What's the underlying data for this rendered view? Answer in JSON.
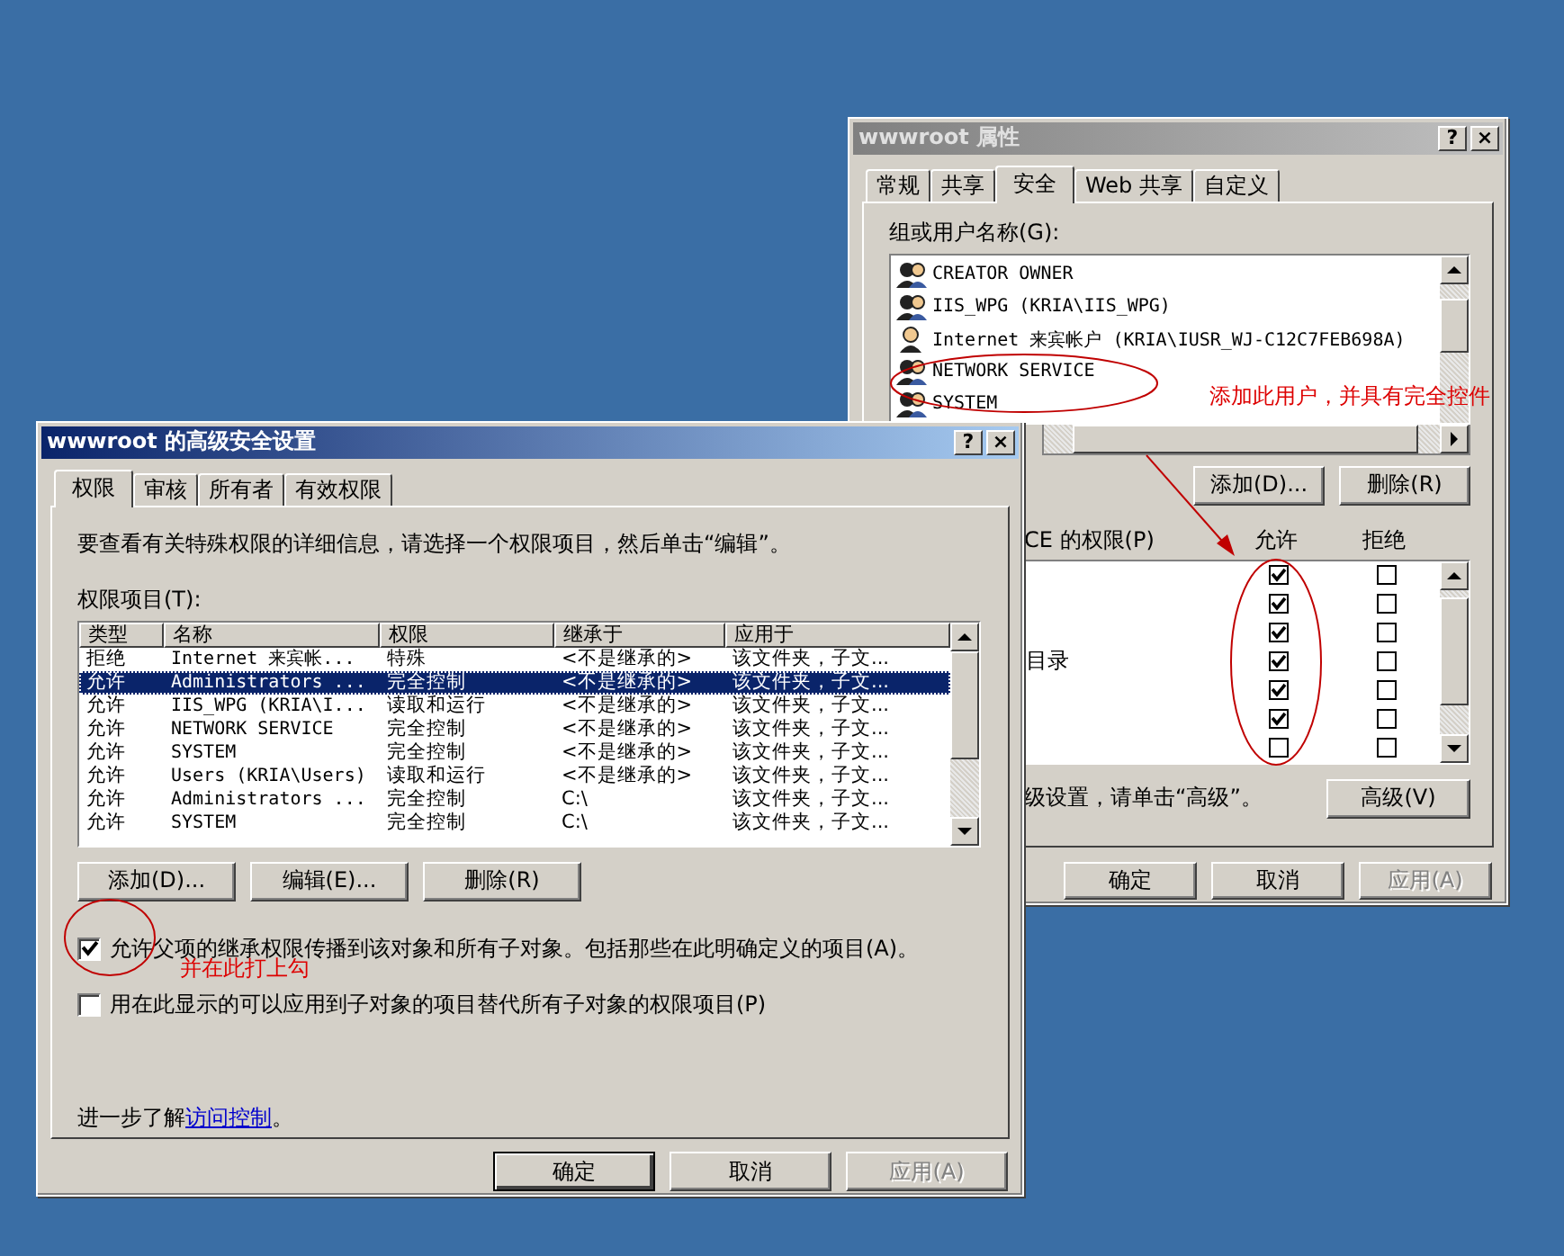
{
  "back_window": {
    "title": "wwwroot 属性",
    "controls": [
      "?",
      "×"
    ],
    "tabs": [
      {
        "label": "常规",
        "selected": false
      },
      {
        "label": "共享",
        "selected": false
      },
      {
        "label": "安全",
        "selected": true
      },
      {
        "label": "Web 共享",
        "selected": false
      },
      {
        "label": "自定义",
        "selected": false
      }
    ],
    "users_label": "组或用户名称(G):",
    "users": [
      {
        "name": "CREATOR OWNER",
        "kind": "group"
      },
      {
        "name": "IIS_WPG (KRIA\\IIS_WPG)",
        "kind": "group"
      },
      {
        "name": "Internet 来宾帐户 (KRIA\\IUSR_WJ-C12C7FEB698A)",
        "kind": "user"
      },
      {
        "name": "NETWORK SERVICE",
        "kind": "group"
      },
      {
        "name": "SYSTEM",
        "kind": "group"
      }
    ],
    "user_buttons": [
      "添加(D)...",
      "删除(R)"
    ],
    "permissions": {
      "label": "CE 的权限(P)",
      "allow_label": "允许",
      "deny_label": "拒绝",
      "rows": [
        {
          "allow": true,
          "deny": false
        },
        {
          "allow": true,
          "deny": false
        },
        {
          "allow": true,
          "deny": false
        },
        {
          "name": "目录",
          "allow": true,
          "deny": false
        },
        {
          "allow": true,
          "deny": false
        },
        {
          "allow": true,
          "deny": false
        },
        {
          "allow": false,
          "deny": false
        }
      ]
    },
    "advanced_hint": "级设置，请单击“高级”。",
    "advanced_button": "高级(V)",
    "buttons": [
      {
        "label": "确定",
        "disabled": false
      },
      {
        "label": "取消",
        "disabled": false
      },
      {
        "label": "应用(A)",
        "disabled": true
      }
    ]
  },
  "front_window": {
    "title": "wwwroot 的高级安全设置",
    "controls": [
      "?",
      "×"
    ],
    "tabs": [
      {
        "label": "权限",
        "selected": true
      },
      {
        "label": "审核",
        "selected": false
      },
      {
        "label": "所有者",
        "selected": false
      },
      {
        "label": "有效权限",
        "selected": false
      }
    ],
    "description": "要查看有关特殊权限的详细信息，请选择一个权限项目，然后单击“编辑”。",
    "entries_label": "权限项目(T):",
    "table": {
      "columns": [
        "类型",
        "名称",
        "权限",
        "继承于",
        "应用于"
      ],
      "rows": [
        {
          "cells": [
            "拒绝",
            "Internet 来宾帐...",
            "特殊",
            "<不是继承的>",
            "该文件夹，子文..."
          ],
          "selected": false
        },
        {
          "cells": [
            "允许",
            "Administrators ...",
            "完全控制",
            "<不是继承的>",
            "该文件夹，子文..."
          ],
          "selected": true
        },
        {
          "cells": [
            "允许",
            "IIS_WPG (KRIA\\I...",
            "读取和运行",
            "<不是继承的>",
            "该文件夹，子文..."
          ],
          "selected": false
        },
        {
          "cells": [
            "允许",
            "NETWORK SERVICE",
            "完全控制",
            "<不是继承的>",
            "该文件夹，子文..."
          ],
          "selected": false
        },
        {
          "cells": [
            "允许",
            "SYSTEM",
            "完全控制",
            "<不是继承的>",
            "该文件夹，子文..."
          ],
          "selected": false
        },
        {
          "cells": [
            "允许",
            "Users (KRIA\\Users)",
            "读取和运行",
            "<不是继承的>",
            "该文件夹，子文..."
          ],
          "selected": false
        },
        {
          "cells": [
            "允许",
            "Administrators ...",
            "完全控制",
            "C:\\",
            "该文件夹，子文..."
          ],
          "selected": false
        },
        {
          "cells": [
            "允许",
            "SYSTEM",
            "完全控制",
            "C:\\",
            "该文件夹，子文..."
          ],
          "selected": false
        }
      ]
    },
    "entry_buttons": [
      "添加(D)...",
      "编辑(E)...",
      "删除(R)"
    ],
    "options": [
      {
        "label": "允许父项的继承权限传播到该对象和所有子对象。包括那些在此明确定义的项目(A)。",
        "checked": true
      },
      {
        "label": "用在此显示的可以应用到子对象的项目替代所有子对象的权限项目(P)",
        "checked": false
      }
    ],
    "learn_more": {
      "text": "进一步了解",
      "link": "访问控制",
      "end": "。"
    },
    "buttons": [
      {
        "label": "确定",
        "disabled": false
      },
      {
        "label": "取消",
        "disabled": false
      },
      {
        "label": "应用(A)",
        "disabled": true
      }
    ]
  },
  "annotations": [
    {
      "kind": "note",
      "text": "添加此用户，并具有完全控件"
    },
    {
      "kind": "note",
      "text": "并在此打上勾"
    }
  ]
}
